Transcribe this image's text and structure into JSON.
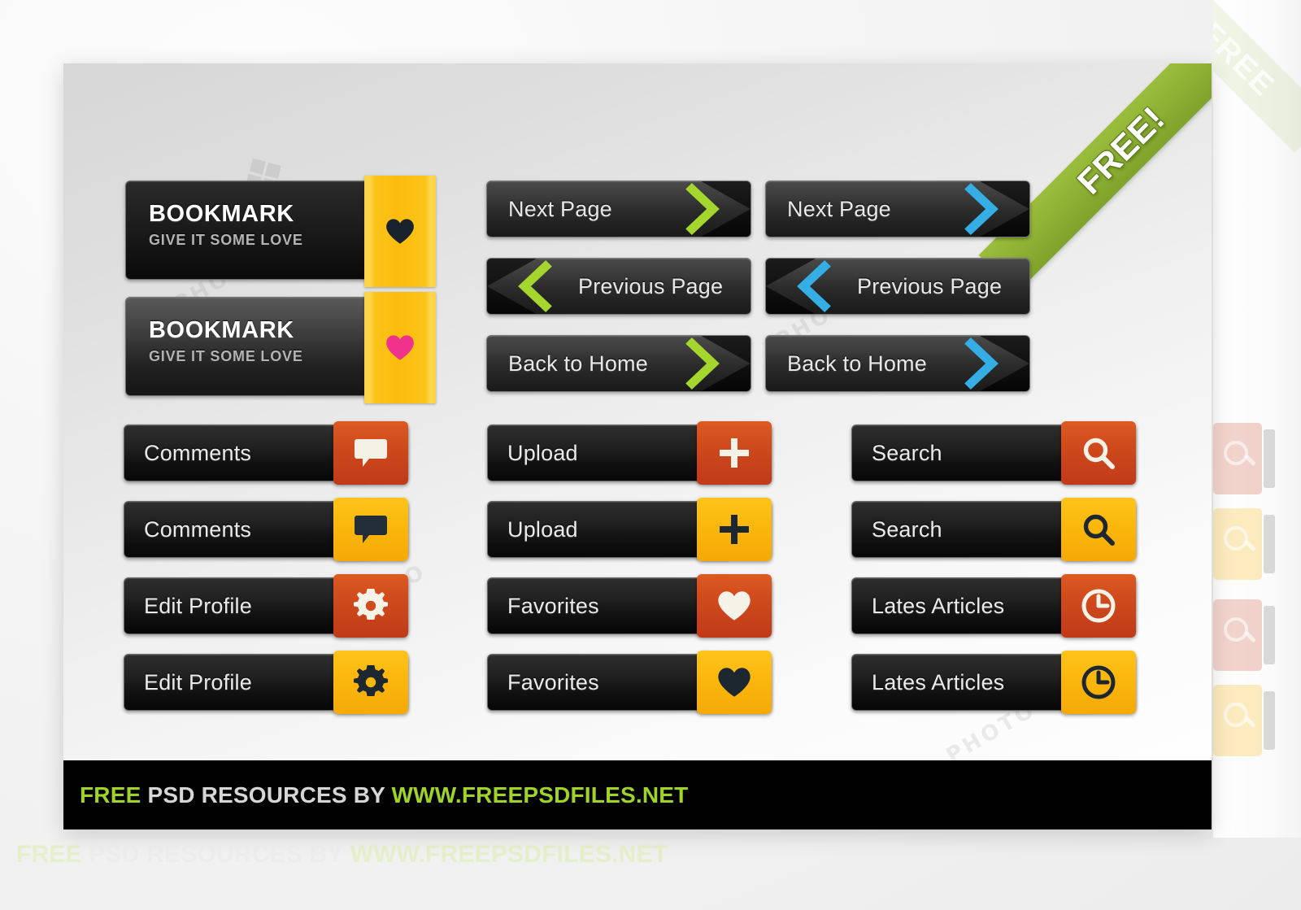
{
  "page": {
    "background_color": "#f2f2f2",
    "card_background": "#e8e8e8"
  },
  "ribbon": {
    "label": "FREE!",
    "color": "#8cb033"
  },
  "colors": {
    "accent_green": "#a4d62e",
    "accent_blue": "#35aee6",
    "tile_red": "#c8401e",
    "tile_yellow": "#fab90f",
    "bookmark_yellow": "#fbc41a",
    "heart_pink": "#f0328c",
    "heart_dark": "#18232e",
    "footer_green": "#9fd327"
  },
  "bookmarks": [
    {
      "title": "BOOKMARK",
      "subtitle": "GIVE IT SOME LOVE",
      "style": "dark",
      "heart_icon": "heart-icon",
      "heart_color": "#18232e"
    },
    {
      "title": "BOOKMARK",
      "subtitle": "GIVE IT SOME LOVE",
      "style": "grey",
      "heart_icon": "heart-icon",
      "heart_color": "#f0328c"
    }
  ],
  "nav_buttons": {
    "green_column": [
      {
        "label": "Next Page",
        "direction": "right",
        "chevron_icon": "chevron-right-icon",
        "color": "#a4d62e"
      },
      {
        "label": "Previous Page",
        "direction": "left",
        "chevron_icon": "chevron-left-icon",
        "color": "#a4d62e"
      },
      {
        "label": "Back to Home",
        "direction": "right",
        "chevron_icon": "chevron-right-icon",
        "color": "#a4d62e"
      }
    ],
    "blue_column": [
      {
        "label": "Next Page",
        "direction": "right",
        "chevron_icon": "chevron-right-icon",
        "color": "#35aee6"
      },
      {
        "label": "Previous Page",
        "direction": "left",
        "chevron_icon": "chevron-left-icon",
        "color": "#35aee6"
      },
      {
        "label": "Back to Home",
        "direction": "right",
        "chevron_icon": "chevron-right-icon",
        "color": "#35aee6"
      }
    ]
  },
  "icon_buttons": {
    "column1": [
      {
        "label": "Comments",
        "icon": "speech-bubble-icon",
        "tile": "red",
        "glyph_color": "#f3f0e6"
      },
      {
        "label": "Comments",
        "icon": "speech-bubble-icon",
        "tile": "yellow",
        "glyph_color": "#232e38"
      },
      {
        "label": "Edit Profile",
        "icon": "gear-icon",
        "tile": "red",
        "glyph_color": "#f5f2e8"
      },
      {
        "label": "Edit Profile",
        "icon": "gear-icon",
        "tile": "yellow",
        "glyph_color": "#1d2730"
      }
    ],
    "column2": [
      {
        "label": "Upload",
        "icon": "plus-icon",
        "tile": "red",
        "glyph_color": "#f5f2e8"
      },
      {
        "label": "Upload",
        "icon": "plus-icon",
        "tile": "yellow",
        "glyph_color": "#1d2730"
      },
      {
        "label": "Favorites",
        "icon": "heart-icon",
        "tile": "red",
        "glyph_color": "#f5f2e8"
      },
      {
        "label": "Favorites",
        "icon": "heart-icon",
        "tile": "yellow",
        "glyph_color": "#1d2730"
      }
    ],
    "column3": [
      {
        "label": "Search",
        "icon": "search-icon",
        "tile": "red",
        "glyph_color": "#f5f2e8"
      },
      {
        "label": "Search",
        "icon": "search-icon",
        "tile": "yellow",
        "glyph_color": "#1d2730"
      },
      {
        "label": "Lates Articles",
        "icon": "clock-icon",
        "tile": "red",
        "glyph_color": "#f5f2e8"
      },
      {
        "label": "Lates Articles",
        "icon": "clock-icon",
        "tile": "yellow",
        "glyph_color": "#1d2730"
      }
    ]
  },
  "footer": {
    "prefix": "FREE",
    "middle": " PSD RESOURCES BY ",
    "url": "WWW.FREEPSDFILES.NET"
  },
  "outside_caption": {
    "prefix": "FREE",
    "middle": " PSD RESOURCES BY ",
    "url": "WWW.FREEPSDFILES.NET"
  }
}
